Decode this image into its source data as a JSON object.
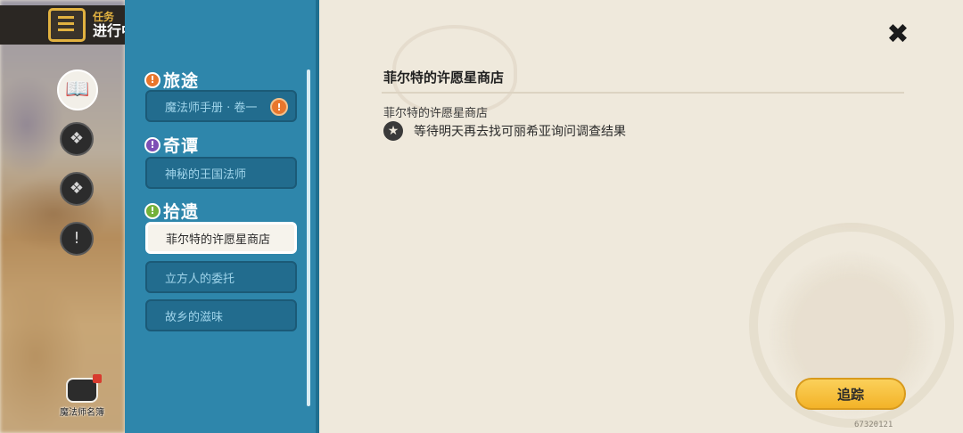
{
  "header": {
    "sub_label": "任务",
    "main_label": "进行中"
  },
  "categories": [
    {
      "icon": "book-icon",
      "active": true
    },
    {
      "icon": "compass-icon",
      "active": false
    },
    {
      "icon": "compass-icon",
      "active": false
    },
    {
      "icon": "exclamation-icon",
      "active": false
    }
  ],
  "wizard_card": {
    "label": "魔法师名簿"
  },
  "sections": [
    {
      "title": "旅途",
      "badge_color": "#e8762c",
      "badge": "!"
    },
    {
      "title": "奇谭",
      "badge_color": "#7e4fb5",
      "badge": "!"
    },
    {
      "title": "拾遗",
      "badge_color": "#73b13a",
      "badge": "!"
    }
  ],
  "quests": [
    {
      "label": "魔法师手册 · 卷一",
      "section": 0,
      "flag": "!"
    },
    {
      "label": "神秘的王国法师",
      "section": 1
    },
    {
      "label": "菲尔特的许愿星商店",
      "section": 2,
      "selected": true
    },
    {
      "label": "立方人的委托",
      "section": 2
    },
    {
      "label": "故乡的滋味",
      "section": 2
    }
  ],
  "detail": {
    "title": "菲尔特的许愿星商店",
    "subtitle": "菲尔特的许愿星商店",
    "task": "等待明天再去找可丽希亚询问调查结果"
  },
  "actions": {
    "close": "✖",
    "track": "追踪"
  },
  "version": "67320121"
}
